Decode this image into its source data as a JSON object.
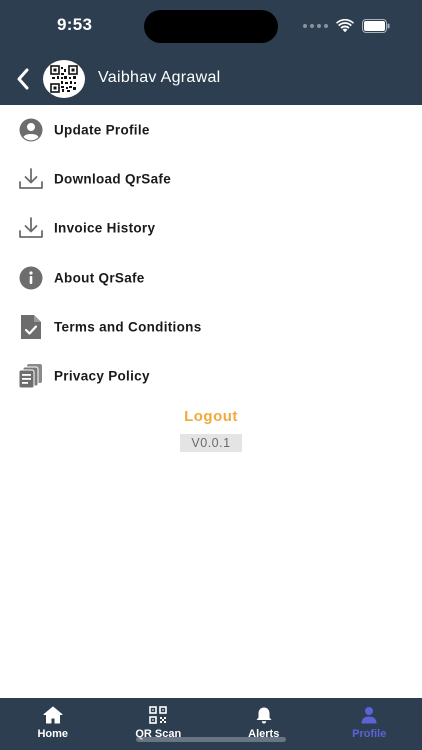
{
  "status_bar": {
    "time": "9:53"
  },
  "header": {
    "user_name": "Vaibhav Agrawal",
    "back_icon": "chevron-left-icon",
    "avatar_icon": "qr-code-icon"
  },
  "menu": {
    "items": [
      {
        "label": "Update Profile",
        "icon": "user-circle-icon"
      },
      {
        "label": "Download QrSafe",
        "icon": "download-icon"
      },
      {
        "label": "Invoice History",
        "icon": "download-icon"
      },
      {
        "label": "About QrSafe",
        "icon": "info-icon"
      },
      {
        "label": "Terms and Conditions",
        "icon": "document-check-icon"
      },
      {
        "label": "Privacy Policy",
        "icon": "documents-stack-icon"
      }
    ]
  },
  "logout_label": "Logout",
  "version": "V0.0.1",
  "tabbar": {
    "tabs": [
      {
        "label": "Home",
        "icon": "home-icon",
        "active": false
      },
      {
        "label": "QR Scan",
        "icon": "qr-scan-icon",
        "active": false
      },
      {
        "label": "Alerts",
        "icon": "bell-icon",
        "active": false
      },
      {
        "label": "Profile",
        "icon": "person-icon",
        "active": true
      }
    ]
  },
  "colors": {
    "header_bg": "#2c3e4f",
    "logout": "#f2a93b",
    "active_tab": "#5b63d6",
    "icon_gray": "#6d6d6d"
  }
}
